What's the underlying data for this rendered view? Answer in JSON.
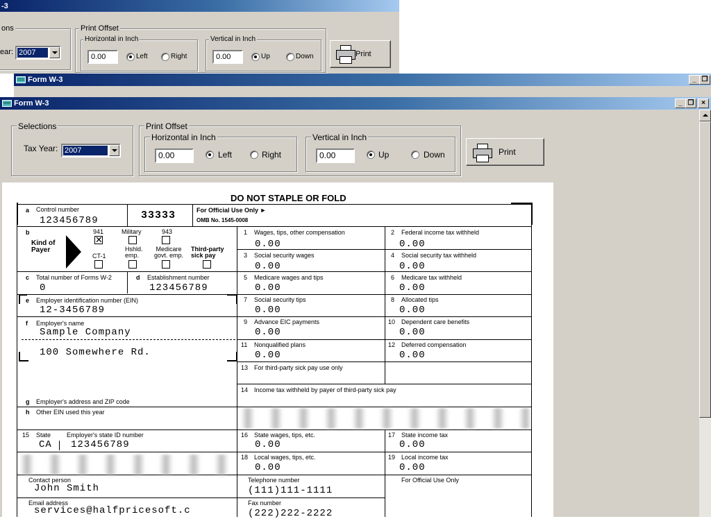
{
  "back_window": {
    "title": "-3",
    "selections_label": "ons",
    "tax_year_label": "ear:",
    "tax_year_value": "2007",
    "print_offset_label": "Print Offset",
    "horizontal_label": "Horizontal in Inch",
    "horizontal_value": "0.00",
    "left_label": "Left",
    "right_label": "Right",
    "vertical_label": "Vertical in Inch",
    "vertical_value": "0.00",
    "up_label": "Up",
    "down_label": "Down",
    "print_label": "Print"
  },
  "mid_window": {
    "title": "Form W-3"
  },
  "main_window": {
    "title": "Form W-3",
    "selections_label": "Selections",
    "tax_year_label": "Tax Year:",
    "tax_year_value": "2007",
    "print_offset_label": "Print Offset",
    "horizontal_label": "Horizontal in Inch",
    "horizontal_value": "0.00",
    "left_label": "Left",
    "right_label": "Right",
    "vertical_label": "Vertical in Inch",
    "vertical_value": "0.00",
    "up_label": "Up",
    "down_label": "Down",
    "print_label": "Print"
  },
  "form": {
    "header": "DO NOT STAPLE OR FOLD",
    "a_letter": "a",
    "control_label": "Control number",
    "control_value": "123456789",
    "code": "33333",
    "official_use": "For Official Use Only ►",
    "omb": "OMB No. 1545-0008",
    "b_letter": "b",
    "kind_of_payer": "Kind of Payer",
    "cb_941": "941",
    "cb_military": "Military",
    "cb_943": "943",
    "cb_ct1": "CT-1",
    "cb_hshld": "Hshld. emp.",
    "cb_medicare": "Medicare govt. emp.",
    "cb_thirdparty": "Third-party sick pay",
    "c_letter": "c",
    "total_forms_label": "Total number of Forms W-2",
    "total_forms_value": "0",
    "d_letter": "d",
    "establishment_label": "Establishment number",
    "establishment_value": "123456789",
    "e_letter": "e",
    "ein_label": "Employer identification number (EIN)",
    "ein_value": "12-3456789",
    "f_letter": "f",
    "employer_name_label": "Employer's name",
    "employer_name_value": "Sample Company",
    "employer_address_value": "100 Somewhere Rd.",
    "g_letter": "g",
    "g_label": "Employer's address and ZIP code",
    "h_letter": "h",
    "h_label": "Other EIN used this year",
    "boxes": [
      {
        "num": "1",
        "label": "Wages, tips, other compensation",
        "value": "0.00"
      },
      {
        "num": "2",
        "label": "Federal income tax withheld",
        "value": "0.00"
      },
      {
        "num": "3",
        "label": "Social security wages",
        "value": "0.00"
      },
      {
        "num": "4",
        "label": "Social security tax withheld",
        "value": "0.00"
      },
      {
        "num": "5",
        "label": "Medicare wages and tips",
        "value": "0.00"
      },
      {
        "num": "6",
        "label": "Medicare tax withheld",
        "value": "0.00"
      },
      {
        "num": "7",
        "label": "Social security tips",
        "value": "0.00"
      },
      {
        "num": "8",
        "label": "Allocated tips",
        "value": "0.00"
      },
      {
        "num": "9",
        "label": "Advance EIC payments",
        "value": "0.00"
      },
      {
        "num": "10",
        "label": "Dependent care benefits",
        "value": "0.00"
      },
      {
        "num": "11",
        "label": "Nonqualified plans",
        "value": "0.00"
      },
      {
        "num": "12",
        "label": "Deferred compensation",
        "value": "0.00"
      }
    ],
    "box13_num": "13",
    "box13_label": "For third-party sick pay use only",
    "box14_num": "14",
    "box14_label": "Income tax withheld by payer of third-party sick pay",
    "box15_num": "15",
    "box15_state_label": "State",
    "box15_id_label": "Employer's state ID number",
    "state_value": "CA",
    "state_id_value": "123456789",
    "box16_num": "16",
    "box16_label": "State wages, tips, etc.",
    "box16_value": "0.00",
    "box17_num": "17",
    "box17_label": "State income tax",
    "box17_value": "0.00",
    "box18_num": "18",
    "box18_label": "Local wages, tips, etc.",
    "box18_value": "0.00",
    "box19_num": "19",
    "box19_label": "Local income tax",
    "box19_value": "0.00",
    "contact_label": "Contact person",
    "contact_value": "John Smith",
    "phone_label": "Telephone number",
    "phone_value": "(111)111-1111",
    "official_use_only": "For Official Use Only",
    "email_label": "Email address",
    "email_value": "services@halfpricesoft.c",
    "fax_label": "Fax number",
    "fax_value": "(222)222-2222"
  }
}
